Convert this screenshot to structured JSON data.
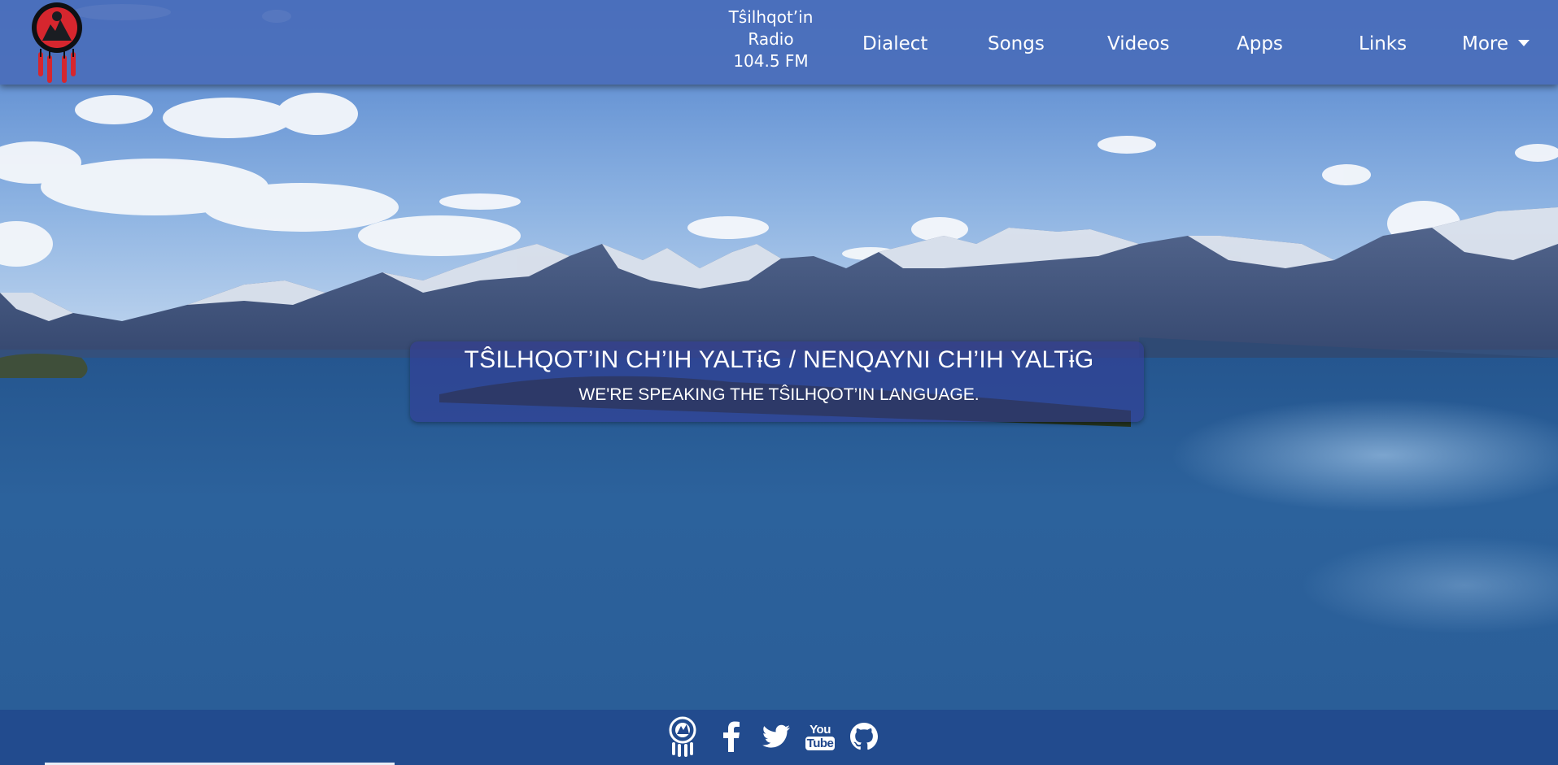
{
  "nav": {
    "radio": {
      "line1": "Tŝilhqot’in",
      "line2": "Radio",
      "line3": "104.5 FM"
    },
    "dialect": "Dialect",
    "songs": "Songs",
    "videos": "Videos",
    "apps": "Apps",
    "links": "Links",
    "more": "More"
  },
  "banner": {
    "title": "TŜILHQOT’IN CH’IH YALTɨG / NENQAYNI CH’IH YALTɨG",
    "subtitle": "WE'RE SPEAKING THE TŜILHQOT’IN LANGUAGE."
  },
  "footer": {
    "icons": [
      "dreamcatcher-icon",
      "facebook-icon",
      "twitter-icon",
      "youtube-icon",
      "github-icon"
    ],
    "youtube_top": "You",
    "youtube_bottom": "Tube"
  },
  "colors": {
    "navbar": "#4a6eba",
    "footer": "#20468c",
    "banner": "#343e96",
    "logo_red": "#d6262e"
  }
}
